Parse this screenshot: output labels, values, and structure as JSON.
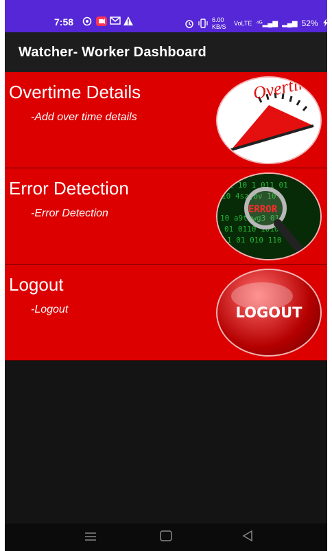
{
  "status_bar": {
    "time": "7:58",
    "network_speed": "6.00 KB/S",
    "battery": "52%",
    "left_icons": [
      "whatsapp-icon",
      "video-record-icon",
      "gmail-icon",
      "warning-icon"
    ],
    "right_icons": [
      "alarm-icon",
      "vibrate-icon",
      "volte-icon",
      "4g-signal-icon",
      "signal-icon",
      "charging-icon"
    ]
  },
  "app_bar": {
    "title": "Watcher- Worker Dashboard"
  },
  "cards": [
    {
      "title": "Overtime Details",
      "subtitle": "-Add over time details",
      "image": "overtime-gauge-image",
      "image_text": "Overtim"
    },
    {
      "title": "Error Detection",
      "subtitle": "-Error Detection",
      "image": "error-magnifier-image",
      "image_text": "ERROR"
    },
    {
      "title": "Logout",
      "subtitle": "-Logout",
      "image": "logout-button-image",
      "image_text": "LOGOUT"
    }
  ],
  "nav_bar": {
    "items": [
      "menu-icon",
      "home-icon",
      "back-icon"
    ]
  },
  "colors": {
    "status_bar": "#5527d6",
    "card": "#dc0000",
    "background": "#141414"
  }
}
